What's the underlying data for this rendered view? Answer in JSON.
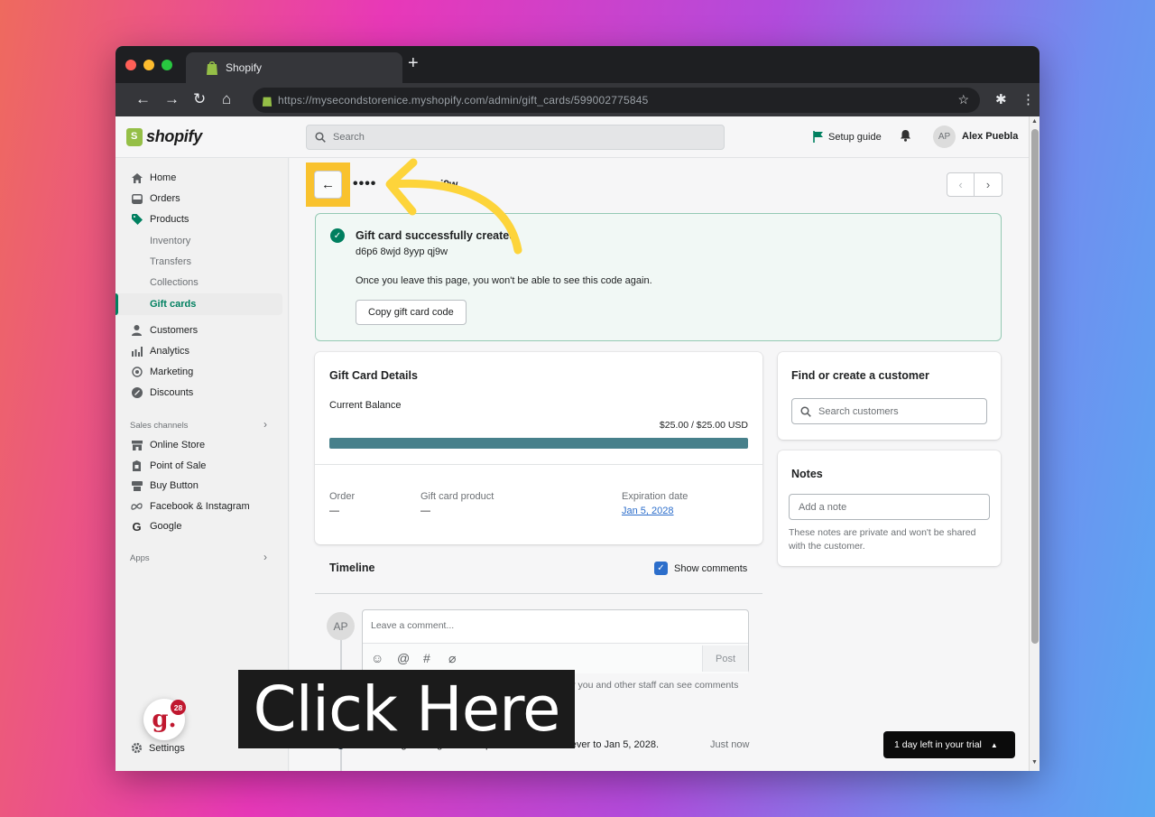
{
  "browser": {
    "tab_title": "Shopify",
    "url": "https://mysecondstorenice.myshopify.com/admin/gift_cards/599002775845"
  },
  "topbar": {
    "logo_text": "shopify",
    "search_placeholder": "Search",
    "setup_guide": "Setup guide",
    "avatar_initials": "AP",
    "user_name": "Alex Puebla"
  },
  "sidebar": {
    "items": [
      {
        "label": "Home",
        "icon": "home-icon"
      },
      {
        "label": "Orders",
        "icon": "orders-icon"
      },
      {
        "label": "Products",
        "icon": "tag-icon"
      }
    ],
    "product_subitems": [
      "Inventory",
      "Transfers",
      "Collections",
      "Gift cards"
    ],
    "items2": [
      {
        "label": "Customers",
        "icon": "person-icon"
      },
      {
        "label": "Analytics",
        "icon": "bar-chart-icon"
      },
      {
        "label": "Marketing",
        "icon": "target-icon"
      },
      {
        "label": "Discounts",
        "icon": "discount-icon"
      }
    ],
    "sales_channels_label": "Sales channels",
    "channels": [
      {
        "label": "Online Store",
        "icon": "store-icon"
      },
      {
        "label": "Point of Sale",
        "icon": "pos-icon"
      },
      {
        "label": "Buy Button",
        "icon": "buy-button-icon"
      },
      {
        "label": "Facebook & Instagram",
        "icon": "meta-icon"
      },
      {
        "label": "Google",
        "icon": "google-icon"
      }
    ],
    "apps_label": "Apps",
    "settings_label": "Settings"
  },
  "page": {
    "title_masked": "••••",
    "title_tail": "j9w"
  },
  "banner": {
    "title": "Gift card successfully created",
    "code": "d6p6 8wjd 8yyp qj9w",
    "note": "Once you leave this page, you won't be able to see this code again.",
    "copy_button": "Copy gift card code"
  },
  "details": {
    "title": "Gift Card Details",
    "current_balance_label": "Current Balance",
    "balance_text": "$25.00 / $25.00 USD",
    "balance_fraction": 1.0,
    "order_label": "Order",
    "order_value": "—",
    "product_label": "Gift card product",
    "product_value": "—",
    "expiration_label": "Expiration date",
    "expiration_value": "Jan 5, 2028"
  },
  "customer": {
    "title": "Find or create a customer",
    "search_placeholder": "Search customers"
  },
  "notes": {
    "title": "Notes",
    "placeholder": "Add a note",
    "help": "These notes are private and won't be shared with the customer."
  },
  "timeline": {
    "title": "Timeline",
    "show_comments_label": "Show comments",
    "avatar_initials": "AP",
    "comment_placeholder": "Leave a comment...",
    "post_button": "Post",
    "staff_note": "Only you and other staff can see comments",
    "event_text": "You changed the gift card expiration date from never to Jan 5, 2028.",
    "event_time": "Just now"
  },
  "trial_banner": "1 day left in your trial",
  "overlay": {
    "click_here": "Click Here",
    "badge_letter": "g.",
    "badge_count": "28",
    "highlight_color": "#f9c22e",
    "arrow_color": "#fdd43a"
  }
}
